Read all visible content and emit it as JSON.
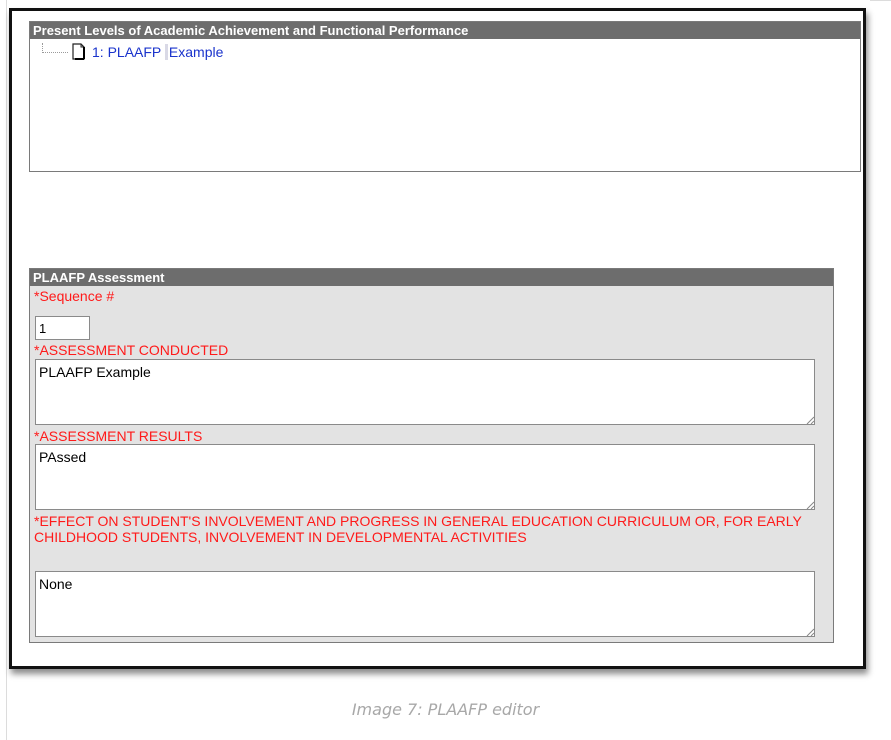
{
  "plaafp_list": {
    "header": "Present Levels of Academic Achievement and Functional Performance",
    "items": [
      {
        "label_main": "1: PLAAFP",
        "label_rest": "Example"
      }
    ]
  },
  "assessment": {
    "header": "PLAAFP Assessment",
    "sequence": {
      "label": "*Sequence #",
      "value": "1"
    },
    "conducted": {
      "label": "*ASSESSMENT CONDUCTED",
      "value": "PLAAFP Example"
    },
    "results": {
      "label": "*ASSESSMENT RESULTS",
      "value": "PAssed"
    },
    "effect": {
      "label": "*EFFECT ON STUDENT'S INVOLVEMENT AND PROGRESS IN GENERAL EDUCATION CURRICULUM OR, FOR EARLY CHILDHOOD STUDENTS, INVOLVEMENT IN DEVELOPMENTAL ACTIVITIES",
      "value": "None"
    }
  },
  "caption": "Image 7: PLAAFP editor",
  "colors": {
    "header_bg": "#6d6d6d",
    "required_label": "#ff1a1a",
    "link": "#1a33cc",
    "panel_bg": "#e3e3e3"
  }
}
